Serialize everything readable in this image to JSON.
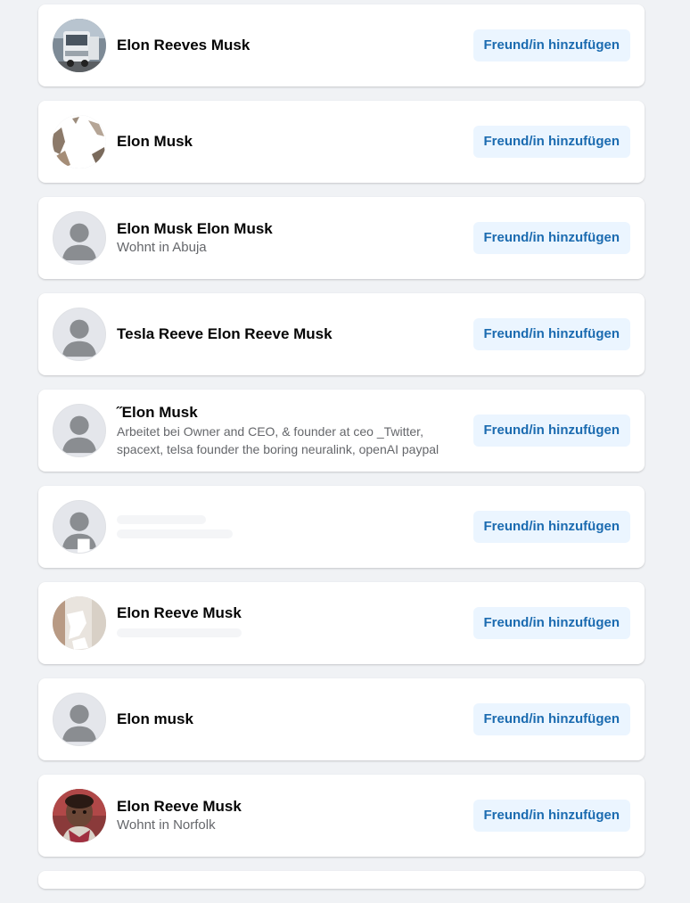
{
  "colors": {
    "page_background": "#f0f2f5",
    "card_background": "#ffffff",
    "button_background": "#ebf5ff",
    "button_text": "#1b6bb0",
    "name_text": "#050505",
    "secondary_text": "#65676b"
  },
  "results": [
    {
      "avatar": "photo-truck",
      "name": "Elon Reeves Musk",
      "subtitle": "",
      "button_label": "Freund/in hinzufügen"
    },
    {
      "avatar": "photo-redacted",
      "name": "Elon Musk",
      "subtitle": "",
      "button_label": "Freund/in hinzufügen"
    },
    {
      "avatar": "default-avatar-icon",
      "name": "Elon Musk Elon Musk",
      "subtitle": "Wohnt in Abuja",
      "button_label": "Freund/in hinzufügen"
    },
    {
      "avatar": "default-avatar-icon",
      "name": "Tesla Reeve Elon Reeve Musk",
      "subtitle": "",
      "button_label": "Freund/in hinzufügen"
    },
    {
      "avatar": "default-avatar-icon",
      "name": "˝Elon Musk",
      "subtitle": "Arbeitet bei Owner and CEO, & founder at ceo _Twitter, spacext, telsa founder the boring neuralink, openAI paypal",
      "button_label": "Freund/in hinzufügen"
    },
    {
      "avatar": "default-avatar-icon",
      "name": "",
      "subtitle": "",
      "button_label": "Freund/in hinzufügen"
    },
    {
      "avatar": "photo-redacted",
      "name": "Elon Reeve Musk",
      "subtitle": "",
      "button_label": "Freund/in hinzufügen"
    },
    {
      "avatar": "default-avatar-icon",
      "name": "Elon musk",
      "subtitle": "",
      "button_label": "Freund/in hinzufügen"
    },
    {
      "avatar": "photo-child",
      "name": "Elon Reeve Musk",
      "subtitle": "Wohnt in Norfolk",
      "button_label": "Freund/in hinzufügen"
    }
  ]
}
